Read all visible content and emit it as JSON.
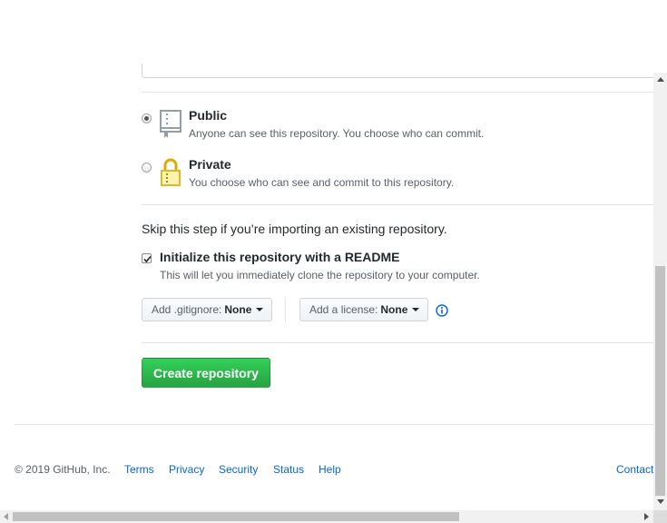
{
  "visibility": {
    "public": {
      "title": "Public",
      "note": "Anyone can see this repository. You choose who can commit.",
      "selected": true,
      "icon": "repo-icon"
    },
    "private": {
      "title": "Private",
      "note": "You choose who can see and commit to this repository.",
      "selected": false,
      "icon": "lock-icon"
    }
  },
  "import_hint": "Skip this step if you’re importing an existing repository.",
  "readme": {
    "label": "Initialize this repository with a README",
    "note": "This will let you immediately clone the repository to your computer.",
    "checked": true
  },
  "gitignore": {
    "prefix": "Add .gitignore:",
    "value": "None"
  },
  "license": {
    "prefix": "Add a license:",
    "value": "None",
    "info_icon": "info-icon"
  },
  "create_button": "Create repository",
  "footer": {
    "copyright": "© 2019 GitHub, Inc.",
    "links": [
      "Terms",
      "Privacy",
      "Security",
      "Status",
      "Help"
    ],
    "right_link": "Contact"
  },
  "colors": {
    "accent_green": "#28a745",
    "link_blue": "#0366d6",
    "text": "#24292e",
    "muted": "#586069",
    "border": "#e1e4e8",
    "icon_gray": "#959da5",
    "lock_gold": "#dbab09"
  }
}
